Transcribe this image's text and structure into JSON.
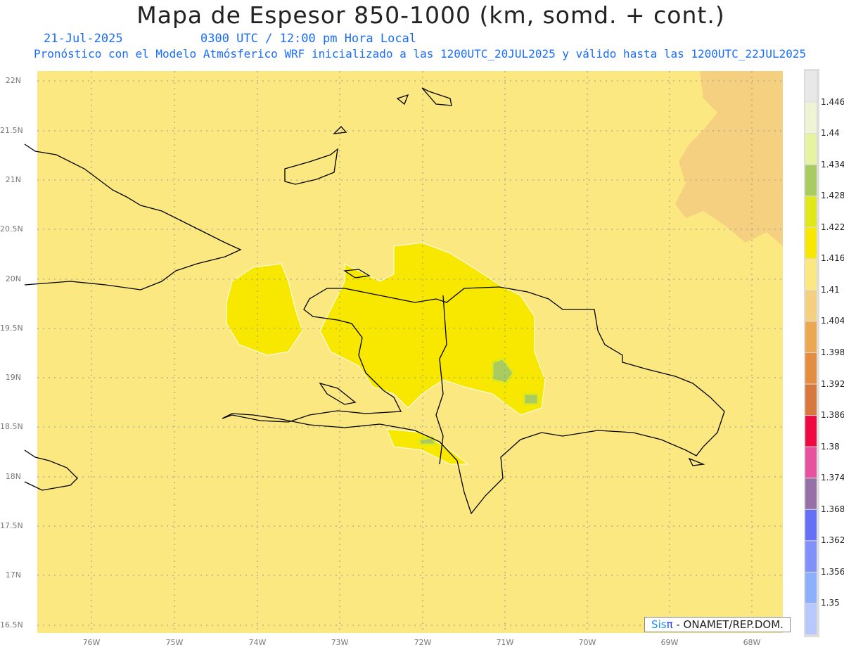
{
  "header": {
    "title": "Mapa de Espesor 850-1000 (km, somd. + cont.)",
    "date": "21-Jul-2025",
    "time": "0300 UTC / 12:00 pm Hora Local",
    "description": "Pronóstico con el Modelo Atmósferico WRF inicializado a las 1200UTC_20JUL2025 y válido hasta las  1200UTC_22JUL2025"
  },
  "axes": {
    "lat_labels": [
      "22N",
      "21.5N",
      "21N",
      "20.5N",
      "20N",
      "19.5N",
      "19N",
      "18.5N",
      "18N",
      "17.5N",
      "17N",
      "16.5N"
    ],
    "lon_labels": [
      "76W",
      "75W",
      "74W",
      "73W",
      "72W",
      "71W",
      "70W",
      "69W",
      "68W"
    ]
  },
  "colorbar": {
    "labels": [
      "1.446",
      "1.44",
      "1.434",
      "1.428",
      "1.422",
      "1.416",
      "1.41",
      "1.404",
      "1.398",
      "1.392",
      "1.386",
      "1.38",
      "1.374",
      "1.368",
      "1.362",
      "1.356",
      "1.35"
    ],
    "colors": [
      "#e8e8e8",
      "#eef4d4",
      "#e6f4a0",
      "#a8cc60",
      "#e0e818",
      "#f8e800",
      "#fce880",
      "#f4d080",
      "#eca850",
      "#e48c40",
      "#d8783c",
      "#f00840",
      "#e850a0",
      "#9870a8",
      "#6470f8",
      "#8090fc",
      "#8cb0ff",
      "#b8c8fc"
    ]
  },
  "credit": {
    "sis": "Sis",
    "pi": "π",
    "rest": "- ONAMET/REP.DOM."
  }
}
